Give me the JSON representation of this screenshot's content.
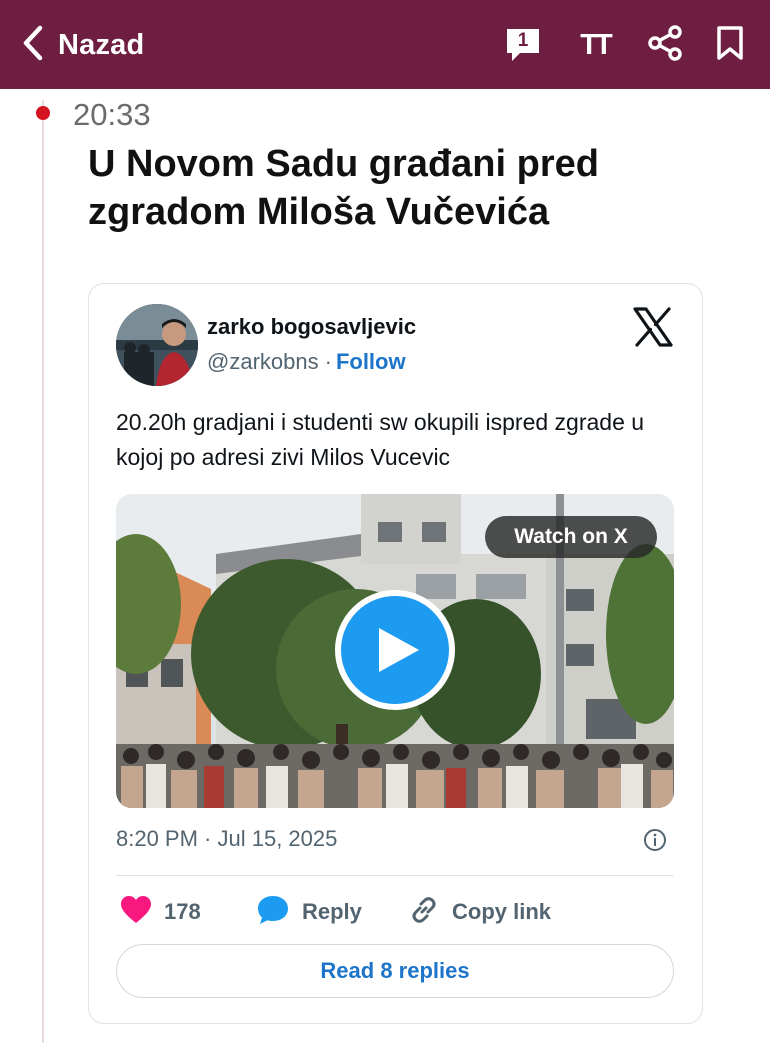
{
  "topbar": {
    "back_label": "Nazad",
    "comments_count": "1",
    "font_size_label": "TT",
    "icons": [
      "chevron-left-icon",
      "comment-icon",
      "text-size-icon",
      "share-icon",
      "bookmark-icon"
    ],
    "background": "#6e1f41"
  },
  "post": {
    "time": "20:33",
    "headline": "U Novom Sadu građani pred zgradom Miloša Vučevića",
    "dot_color": "#d3131f"
  },
  "tweet": {
    "author": "zarko bogosavljevic",
    "handle": "@zarkobns",
    "separator": "·",
    "follow_label": "Follow",
    "text": "20.20h gradjani i studenti sw okupili ispred zgrade u kojoj po adresi zivi Milos Vucevic",
    "watch_label": "Watch on X",
    "date": "8:20 PM · Jul 15, 2025",
    "likes": "178",
    "reply_label": "Reply",
    "copy_label": "Copy link",
    "read_replies_label": "Read 8 replies",
    "accent": "#1d74c9",
    "like_color": "#f91880"
  }
}
